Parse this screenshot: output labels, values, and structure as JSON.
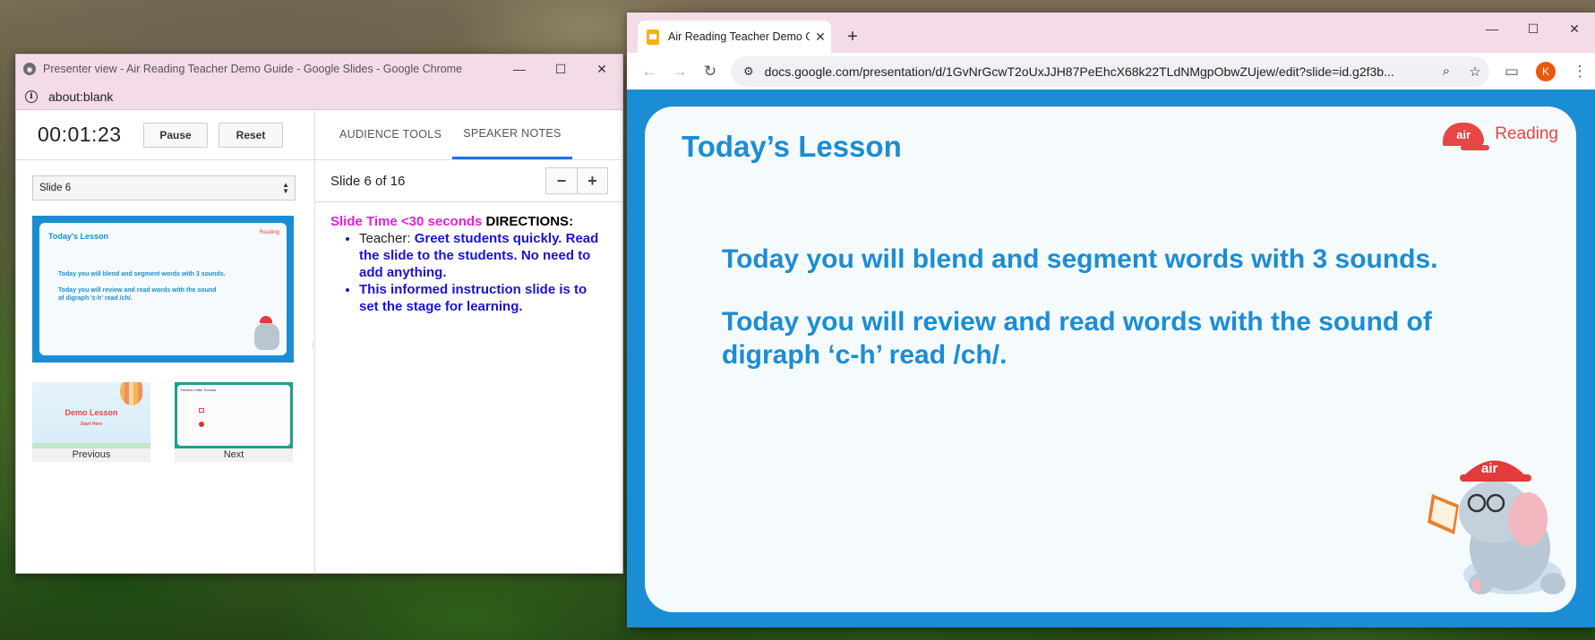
{
  "presenter": {
    "window_title": "Presenter view - Air Reading Teacher Demo Guide - Google Slides - Google Chrome",
    "url": "about:blank",
    "timer": "00:01:23",
    "pause_label": "Pause",
    "reset_label": "Reset",
    "slide_select_value": "Slide 6",
    "current_thumb": {
      "title": "Today's Lesson",
      "logo": "Reading",
      "line1": "Today you will blend and segment words with 3 sounds.",
      "line2a": "Today you will review and read words with the sound",
      "line2b": "of digraph 'c-h' read /ch/."
    },
    "previous": {
      "caption": "Previous",
      "title": "Demo Lesson",
      "subtitle": "Start Here"
    },
    "next": {
      "caption": "Next",
      "title": "Review Letter Sounds"
    },
    "tabs": [
      "AUDIENCE TOOLS",
      "SPEAKER NOTES"
    ],
    "active_tab": "SPEAKER NOTES",
    "slide_counter": "Slide 6 of 16",
    "zoom_out": "−",
    "zoom_in": "+",
    "notes": {
      "time_label": "Slide Time <30 seconds",
      "directions": " DIRECTIONS:",
      "bullet1_prefix": "Teacher: ",
      "bullet1_text": "Greet students quickly. Read the slide to the students. No need to add anything.",
      "bullet2_text": "This informed instruction slide is to set the stage for learning."
    }
  },
  "chrome": {
    "tab_title": "Air Reading Teacher Demo Guide",
    "url": "docs.google.com/presentation/d/1GvNrGcwT2oUxJJH87PeEhcX68k22TLdNMgpObwZUjew/edit?slide=id.g2f3b...",
    "avatar_letter": "K"
  },
  "slide": {
    "title": "Today’s Lesson",
    "logo_cap": "air",
    "logo_word": "Reading",
    "line1": "Today you will blend and segment words with 3 sounds.",
    "line2": "Today you will review and read words with the sound of digraph ‘c-h’ read /ch/."
  },
  "colors": {
    "slide_blue": "#1b8dd4",
    "brand_red": "#e84545",
    "notes_magenta": "#e81ed6",
    "notes_blue": "#1a12d8"
  }
}
